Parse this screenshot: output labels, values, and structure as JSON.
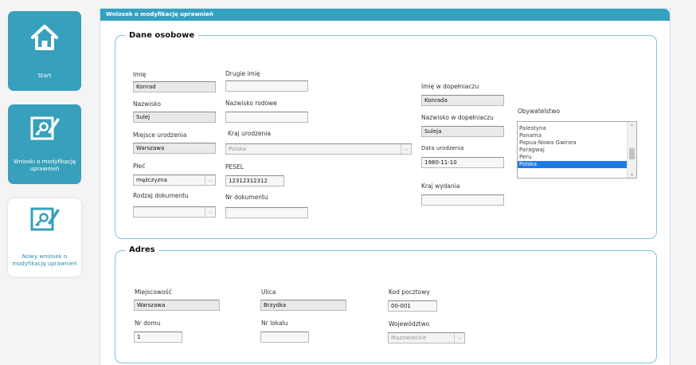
{
  "sidebar": {
    "tiles": [
      {
        "label": "Start",
        "icon": "home-icon"
      },
      {
        "label": "Wnioski o modyfikację uprawnień",
        "icon": "edit-key-icon"
      },
      {
        "label": "Nowy wniosek o modyfikację uprawnień",
        "icon": "edit-key-icon"
      }
    ]
  },
  "panel": {
    "title": "Wniosek o modyfikację uprawnień"
  },
  "personal": {
    "legend": "Dane osobowe",
    "first_name_label": "Imię",
    "first_name": "Konrad",
    "middle_name_label": "Drugie imię",
    "middle_name": "",
    "last_name_label": "Nazwisko",
    "last_name": "Sulej",
    "family_name_label": "Nazwisko rodowe",
    "family_name": "",
    "birth_place_label": "Miejsce urodzenia",
    "birth_place": "Warszawa",
    "birth_country_label": "Kraj urodzenia",
    "birth_country": "Polska",
    "sex_label": "Płeć",
    "sex": "mężczyzna",
    "pesel_label": "PESEL",
    "pesel": "12312312312",
    "doc_type_label": "Rodzaj dokumentu",
    "doc_type": "",
    "doc_number_label": "Nr dokumentu",
    "doc_number": "",
    "first_name_gen_label": "Imię w dopełniaczu",
    "first_name_gen": "Konrada",
    "last_name_gen_label": "Nazwisko w dopełniaczu",
    "last_name_gen": "Suleja",
    "birth_date_label": "Data urodzenia",
    "birth_date": "1980-11-10",
    "issue_country_label": "Kraj wydania",
    "issue_country": "",
    "citizenship_label": "Obywatelstwo",
    "citizenship_options": [
      "Palestyna",
      "Panama",
      "Papua-Nowa Gwinea",
      "Paragwaj",
      "Peru",
      "Polska"
    ],
    "citizenship_selected": "Polska"
  },
  "address": {
    "legend": "Adres",
    "city_label": "Miejscowość",
    "city": "Warszawa",
    "street_label": "Ulica",
    "street": "Brzydka",
    "postal_label": "Kod pocztowy",
    "postal": "00-001",
    "house_label": "Nr domu",
    "house": "1",
    "flat_label": "Nr lokalu",
    "flat": "",
    "voivodeship_label": "Województwo",
    "voivodeship": "Mazowieckie"
  },
  "colors": {
    "accent": "#33a1c0",
    "tile": "#37a0bc",
    "selection": "#1f7ae3"
  }
}
